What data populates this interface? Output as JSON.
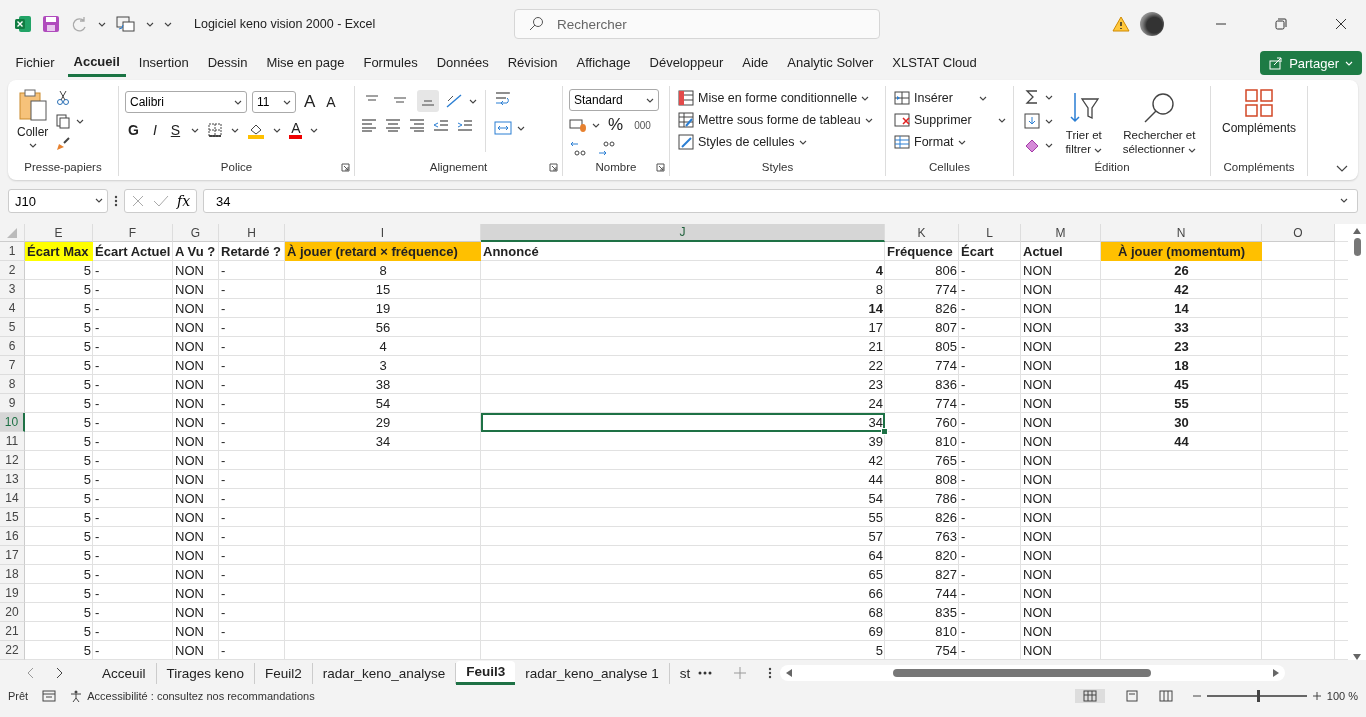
{
  "title_bar": {
    "title": "Logiciel keno vision 2000  -  Excel",
    "search": {
      "placeholder": "Rechercher"
    }
  },
  "menu_tabs": [
    {
      "label": "Fichier",
      "selected": false
    },
    {
      "label": "Accueil",
      "selected": true
    },
    {
      "label": "Insertion",
      "selected": false
    },
    {
      "label": "Dessin",
      "selected": false
    },
    {
      "label": "Mise en page",
      "selected": false
    },
    {
      "label": "Formules",
      "selected": false
    },
    {
      "label": "Données",
      "selected": false
    },
    {
      "label": "Révision",
      "selected": false
    },
    {
      "label": "Affichage",
      "selected": false
    },
    {
      "label": "Développeur",
      "selected": false
    },
    {
      "label": "Aide",
      "selected": false
    },
    {
      "label": "Analytic Solver",
      "selected": false
    },
    {
      "label": "XLSTAT Cloud",
      "selected": false
    }
  ],
  "share_button": "Partager",
  "ribbon": {
    "clipboard": {
      "paste": "Coller",
      "label": "Presse-papiers"
    },
    "font": {
      "family": "Calibri",
      "size": "11",
      "grow": "A",
      "shrink": "A",
      "bold": "G",
      "italic": "I",
      "underline": "S",
      "font_color_label": "A",
      "label": "Police"
    },
    "alignment": {
      "vertical": [
        {
          "selected": false
        },
        {
          "selected": false
        },
        {
          "selected": true
        }
      ],
      "label": "Alignement"
    },
    "number": {
      "format": "Standard",
      "percent": "%",
      "thousands": "000",
      "label": "Nombre"
    },
    "styles": {
      "items": [
        "Mise en forme conditionnelle",
        "Mettre sous forme de tableau",
        "Styles de cellules"
      ],
      "label": "Styles"
    },
    "cells": {
      "items": [
        "Insérer",
        "Supprimer",
        "Format"
      ],
      "label": "Cellules"
    },
    "editing": {
      "sort": "Trier et filtrer",
      "find": "Rechercher et sélectionner",
      "label": "Édition"
    },
    "addins": {
      "button": "Compléments",
      "label": "Compléments"
    }
  },
  "formula_bar": {
    "name_box": "J10",
    "function_button": "fx",
    "value": "34"
  },
  "columns": [
    {
      "label": "E",
      "selected": false
    },
    {
      "label": "F",
      "selected": false
    },
    {
      "label": "G",
      "selected": false
    },
    {
      "label": "H",
      "selected": false
    },
    {
      "label": "I",
      "selected": false
    },
    {
      "label": "J",
      "selected": true
    },
    {
      "label": "K",
      "selected": false
    },
    {
      "label": "L",
      "selected": false
    },
    {
      "label": "M",
      "selected": false
    },
    {
      "label": "N",
      "selected": false
    },
    {
      "label": "O",
      "selected": false
    }
  ],
  "header_row": {
    "number": "1",
    "cells": [
      {
        "text": "Écart Max",
        "color": "#ffff00"
      },
      {
        "text": "Écart Actuel"
      },
      {
        "text": "A Vu ?"
      },
      {
        "text": "Retardé ?"
      },
      {
        "text": "À jouer (retard × fréquence)",
        "color": "#ffc000"
      },
      {
        "text": "Annoncé"
      },
      {
        "text": "Fréquence"
      },
      {
        "text": "Écart"
      },
      {
        "text": "Actuel"
      },
      {
        "text": "À jouer (momentum)",
        "color": "#ffc000"
      }
    ]
  },
  "rows": [
    {
      "number": "2",
      "selected": false,
      "e": "5",
      "f": "-",
      "g": "NON",
      "h": "-",
      "i": "8",
      "j": "4",
      "j_bold": true,
      "k": "806",
      "l": "-",
      "m": "NON",
      "n": "26"
    },
    {
      "number": "3",
      "selected": false,
      "e": "5",
      "f": "-",
      "g": "NON",
      "h": "-",
      "i": "15",
      "j": "8",
      "j_bold": false,
      "k": "774",
      "l": "-",
      "m": "NON",
      "n": "42"
    },
    {
      "number": "4",
      "selected": false,
      "e": "5",
      "f": "-",
      "g": "NON",
      "h": "-",
      "i": "19",
      "j": "14",
      "j_bold": true,
      "k": "826",
      "l": "-",
      "m": "NON",
      "n": "14"
    },
    {
      "number": "5",
      "selected": false,
      "e": "5",
      "f": "-",
      "g": "NON",
      "h": "-",
      "i": "56",
      "j": "17",
      "j_bold": false,
      "k": "807",
      "l": "-",
      "m": "NON",
      "n": "33"
    },
    {
      "number": "6",
      "selected": false,
      "e": "5",
      "f": "-",
      "g": "NON",
      "h": "-",
      "i": "4",
      "j": "21",
      "j_bold": false,
      "k": "805",
      "l": "-",
      "m": "NON",
      "n": "23"
    },
    {
      "number": "7",
      "selected": false,
      "e": "5",
      "f": "-",
      "g": "NON",
      "h": "-",
      "i": "3",
      "j": "22",
      "j_bold": false,
      "k": "774",
      "l": "-",
      "m": "NON",
      "n": "18"
    },
    {
      "number": "8",
      "selected": false,
      "e": "5",
      "f": "-",
      "g": "NON",
      "h": "-",
      "i": "38",
      "j": "23",
      "j_bold": false,
      "k": "836",
      "l": "-",
      "m": "NON",
      "n": "45"
    },
    {
      "number": "9",
      "selected": false,
      "e": "5",
      "f": "-",
      "g": "NON",
      "h": "-",
      "i": "54",
      "j": "24",
      "j_bold": false,
      "k": "774",
      "l": "-",
      "m": "NON",
      "n": "55"
    },
    {
      "number": "10",
      "selected": true,
      "e": "5",
      "f": "-",
      "g": "NON",
      "h": "-",
      "i": "29",
      "j": "34",
      "j_bold": false,
      "k": "760",
      "l": "-",
      "m": "NON",
      "n": "30"
    },
    {
      "number": "11",
      "selected": false,
      "e": "5",
      "f": "-",
      "g": "NON",
      "h": "-",
      "i": "34",
      "j": "39",
      "j_bold": false,
      "k": "810",
      "l": "-",
      "m": "NON",
      "n": "44"
    },
    {
      "number": "12",
      "selected": false,
      "e": "5",
      "f": "-",
      "g": "NON",
      "h": "-",
      "j": "42",
      "j_bold": false,
      "k": "765",
      "l": "-",
      "m": "NON"
    },
    {
      "number": "13",
      "selected": false,
      "e": "5",
      "f": "-",
      "g": "NON",
      "h": "-",
      "j": "44",
      "j_bold": false,
      "k": "808",
      "l": "-",
      "m": "NON"
    },
    {
      "number": "14",
      "selected": false,
      "e": "5",
      "f": "-",
      "g": "NON",
      "h": "-",
      "j": "54",
      "j_bold": false,
      "k": "786",
      "l": "-",
      "m": "NON"
    },
    {
      "number": "15",
      "selected": false,
      "e": "5",
      "f": "-",
      "g": "NON",
      "h": "-",
      "j": "55",
      "j_bold": false,
      "k": "826",
      "l": "-",
      "m": "NON"
    },
    {
      "number": "16",
      "selected": false,
      "e": "5",
      "f": "-",
      "g": "NON",
      "h": "-",
      "j": "57",
      "j_bold": false,
      "k": "763",
      "l": "-",
      "m": "NON"
    },
    {
      "number": "17",
      "selected": false,
      "e": "5",
      "f": "-",
      "g": "NON",
      "h": "-",
      "j": "64",
      "j_bold": false,
      "k": "820",
      "l": "-",
      "m": "NON"
    },
    {
      "number": "18",
      "selected": false,
      "e": "5",
      "f": "-",
      "g": "NON",
      "h": "-",
      "j": "65",
      "j_bold": false,
      "k": "827",
      "l": "-",
      "m": "NON"
    },
    {
      "number": "19",
      "selected": false,
      "e": "5",
      "f": "-",
      "g": "NON",
      "h": "-",
      "j": "66",
      "j_bold": false,
      "k": "744",
      "l": "-",
      "m": "NON"
    },
    {
      "number": "20",
      "selected": false,
      "e": "5",
      "f": "-",
      "g": "NON",
      "h": "-",
      "j": "68",
      "j_bold": false,
      "k": "835",
      "l": "-",
      "m": "NON"
    },
    {
      "number": "21",
      "selected": false,
      "e": "5",
      "f": "-",
      "g": "NON",
      "h": "-",
      "j": "69",
      "j_bold": false,
      "k": "810",
      "l": "-",
      "m": "NON"
    },
    {
      "number": "22",
      "selected": false,
      "e": "5",
      "f": "-",
      "g": "NON",
      "h": "-",
      "j": "5",
      "j_bold": false,
      "k": "754",
      "l": "-",
      "m": "NON"
    }
  ],
  "sheet_tabs": [
    {
      "label": "Acceuil",
      "selected": false
    },
    {
      "label": "Tirages keno",
      "selected": false
    },
    {
      "label": "Feuil2",
      "selected": false
    },
    {
      "label": "radar_keno_analyse",
      "selected": false
    },
    {
      "label": "Feuil3",
      "selected": true
    },
    {
      "label": "radar_keno_analyse 1",
      "selected": false
    },
    {
      "label": "st",
      "selected": false
    }
  ],
  "status_bar": {
    "mode": "Prêt",
    "accessibility": "Accessibilité : consultez nos recommandations",
    "zoom": {
      "level": 0.5,
      "reading": "100 %"
    }
  }
}
